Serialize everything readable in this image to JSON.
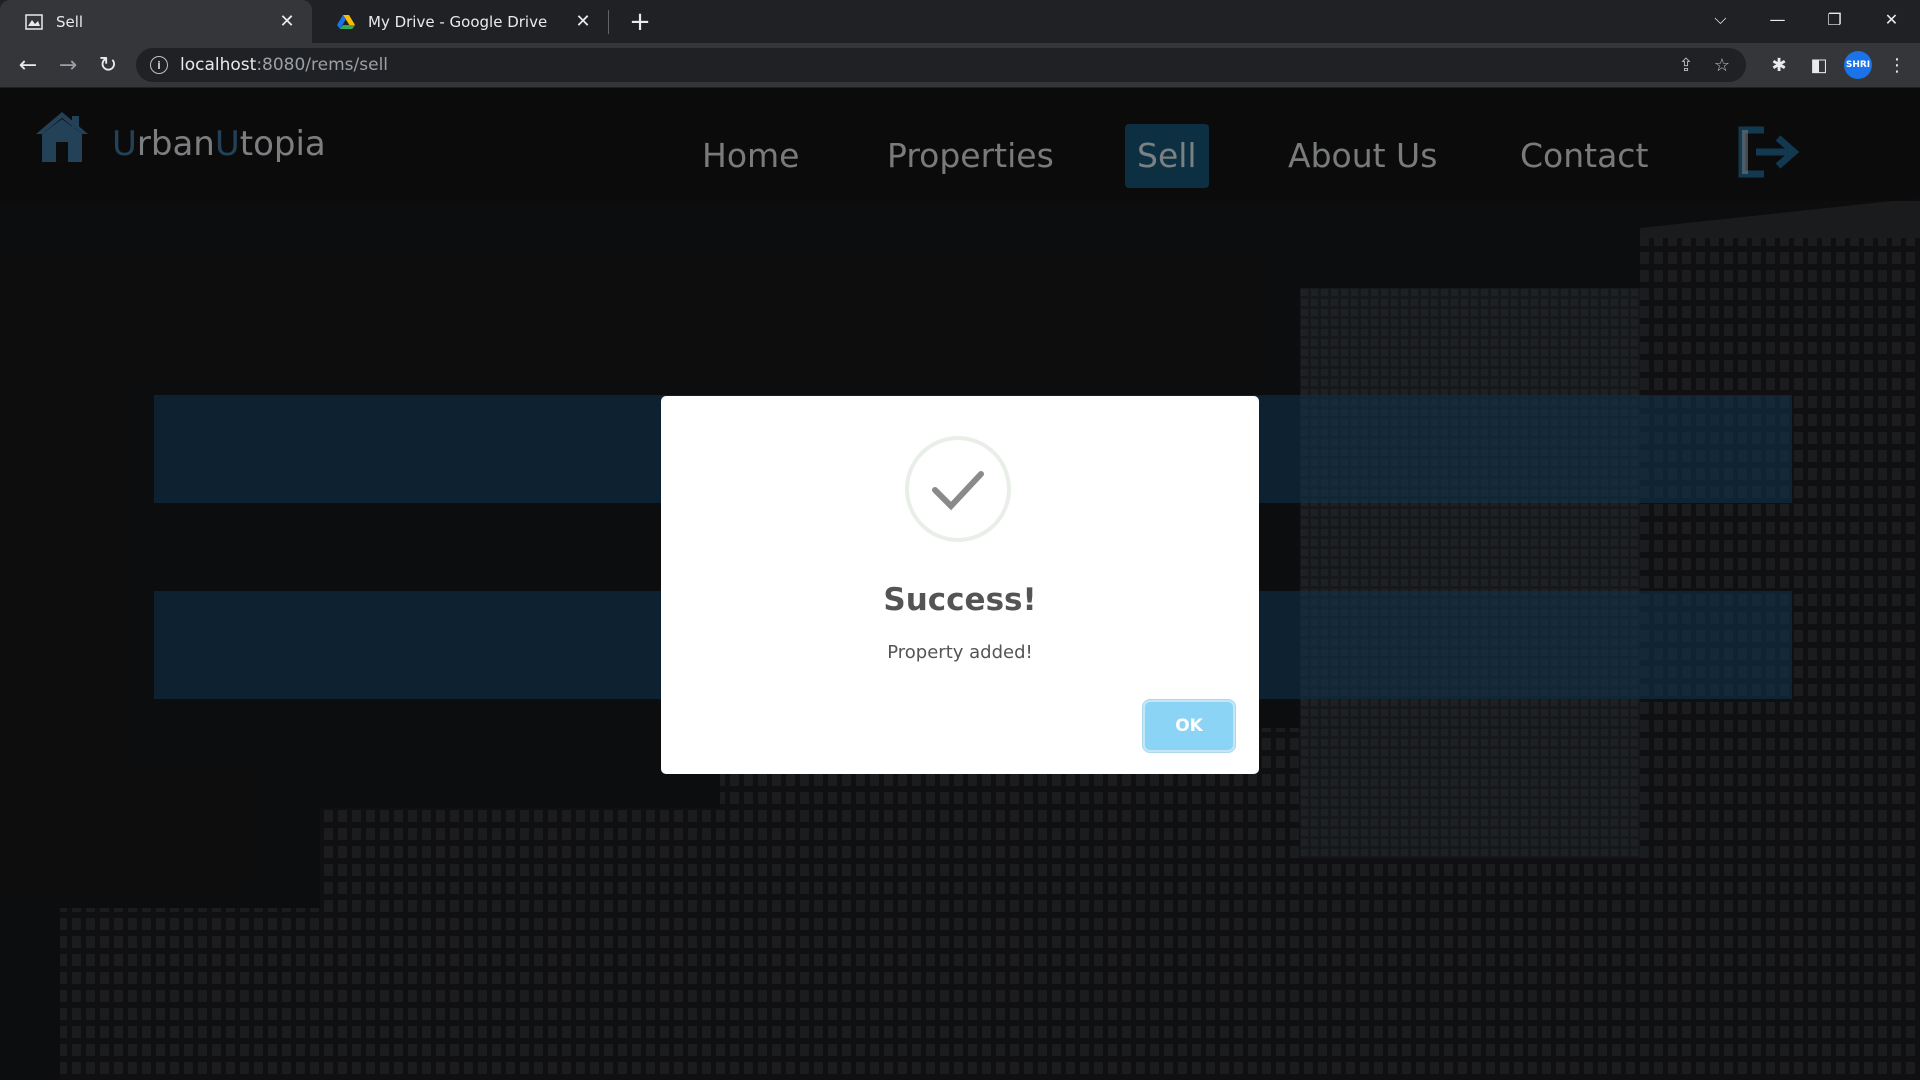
{
  "browser": {
    "tabs": [
      {
        "title": "Sell",
        "active": true,
        "favicon": "page-favicon-icon"
      },
      {
        "title": "My Drive - Google Drive",
        "active": false,
        "favicon": "google-drive-icon"
      }
    ],
    "new_tab_label": "+",
    "url_host": "localhost",
    "url_path": ":8080/rems/sell",
    "profile_label": "SHRI"
  },
  "site": {
    "brand_first": "U",
    "brand_mid": "rban",
    "brand_second": "U",
    "brand_last": "topia",
    "nav": {
      "home": "Home",
      "properties": "Properties",
      "sell": "Sell",
      "about": "About Us",
      "contact": "Contact"
    },
    "active_nav": "Sell",
    "accent_color": "#14506e"
  },
  "dialog": {
    "title": "Success!",
    "message": "Property added!",
    "ok_label": "OK",
    "icon": "success-check-icon",
    "button_color": "#8cd4f5"
  }
}
